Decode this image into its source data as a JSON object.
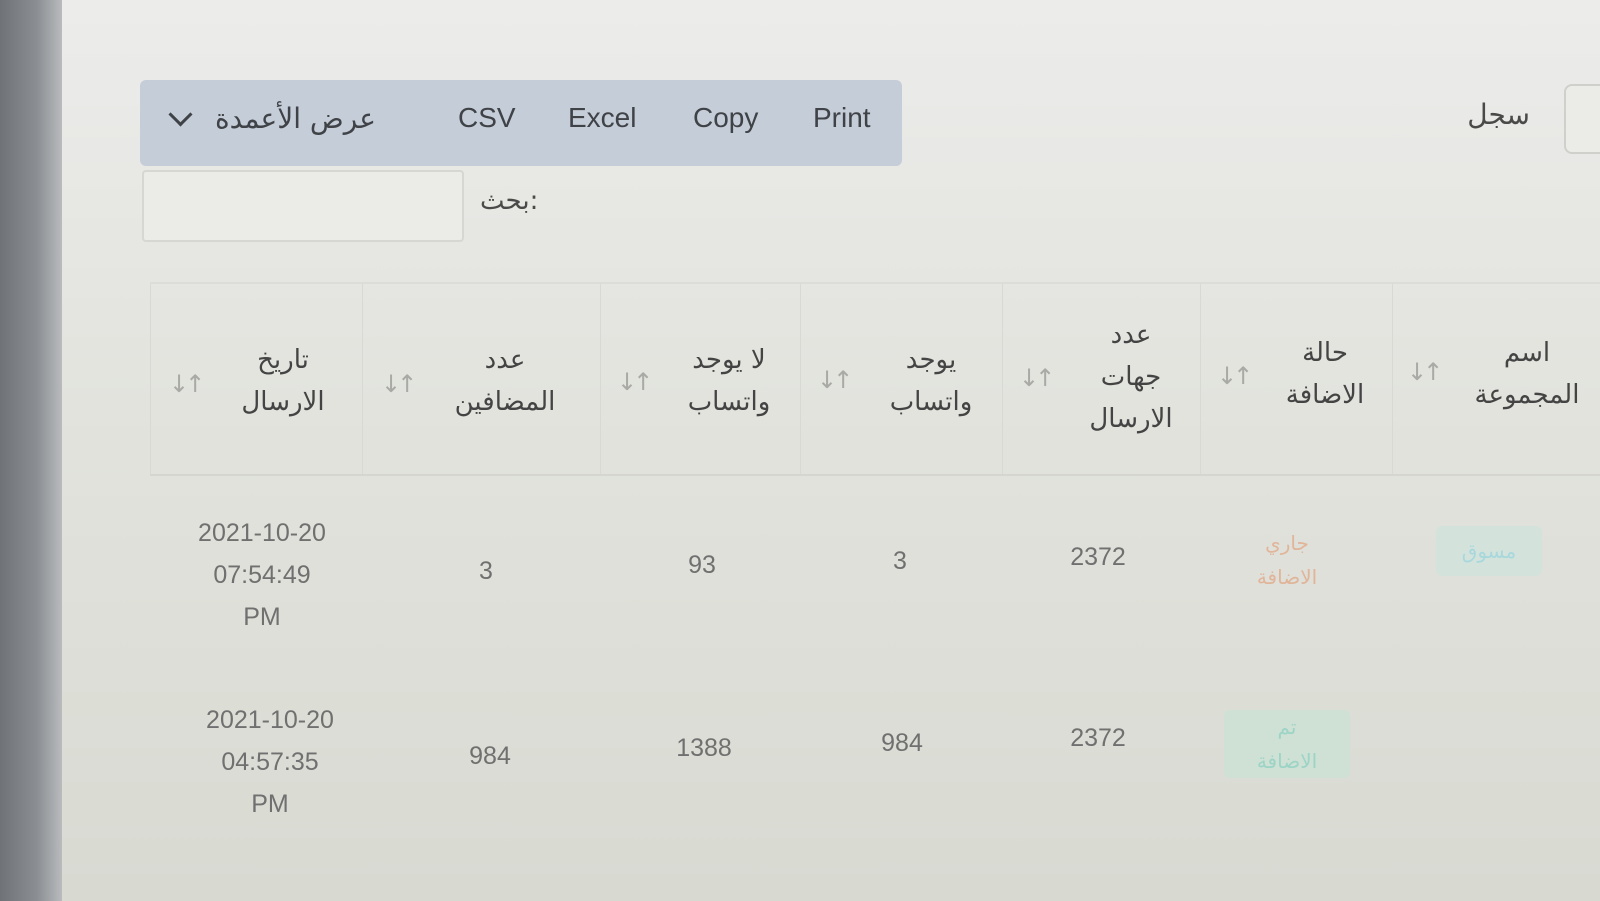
{
  "toolbar": {
    "column_visibility": "عرض الأعمدة",
    "csv": "CSV",
    "excel": "Excel",
    "copy": "Copy",
    "print": "Print"
  },
  "entries": {
    "label": "سجل"
  },
  "search": {
    "label": "بحث:",
    "value": ""
  },
  "table": {
    "headers": [
      "تاريخ\nالارسال",
      "عدد\nالمضافين",
      "لا يوجد\nواتساب",
      "يوجد\nواتساب",
      "عدد\nجهات\nالارسال",
      "حالة\nالاضافة",
      "اسم\nالمجموعة"
    ],
    "sort_icon": "↓↑",
    "rows": [
      {
        "date": "2021-10-20\n07:54:49\nPM",
        "added": "3",
        "no_whatsapp": "93",
        "has_whatsapp": "3",
        "contacts": "2372",
        "status": "جاري\nالاضافة",
        "group": "مسوق"
      },
      {
        "date": "2021-10-20\n04:57:35\nPM",
        "added": "984",
        "no_whatsapp": "1388",
        "has_whatsapp": "984",
        "contacts": "2372",
        "status": "تم\nالاضافة",
        "group": ""
      }
    ]
  },
  "colors": {
    "toolbar_bg": "#c5cdd8",
    "status_running": "#e0b59a",
    "status_done": "#9cd4c6",
    "group_badge": "#a8d8dc"
  }
}
